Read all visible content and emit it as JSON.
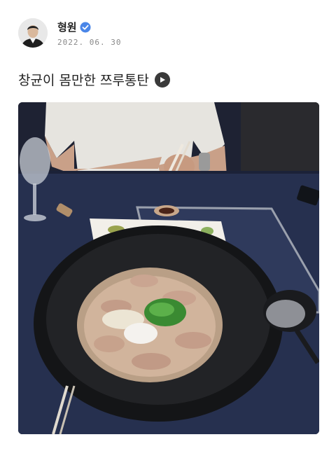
{
  "post": {
    "author": "형원",
    "verified_icon": "verified-badge-icon",
    "date": "2022. 06. 30",
    "text": "창균이 몸만한 쯔루통탄",
    "play_icon": "play-icon",
    "accent": "#4a86e8"
  }
}
